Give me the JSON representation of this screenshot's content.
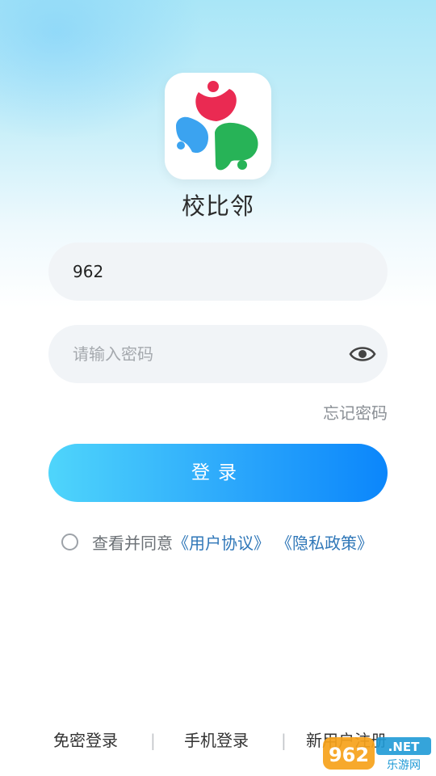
{
  "app": {
    "name": "校比邻"
  },
  "login_form": {
    "username_value": "962",
    "password_placeholder": "请输入密码",
    "forgot_password_label": "忘记密码",
    "login_button_label": "登录"
  },
  "agreement": {
    "prefix_text": "查看并同意",
    "user_agreement_link": "《用户协议》",
    "privacy_policy_link": "《隐私政策》",
    "checked": false
  },
  "bottom_nav": {
    "items": [
      "免密登录",
      "手机登录",
      "新用户注册"
    ]
  },
  "watermark": {
    "brand_text": "962",
    "suffix_text": ".NET",
    "sub_text": "乐游网"
  },
  "colors": {
    "primary_gradient_start": "#4fd5fb",
    "primary_gradient_end": "#0b86fb",
    "link": "#2f77b8",
    "field_bg": "#f1f4f7",
    "logo_red": "#ea2a52",
    "logo_blue": "#3ba3f0",
    "logo_green": "#27b357"
  }
}
